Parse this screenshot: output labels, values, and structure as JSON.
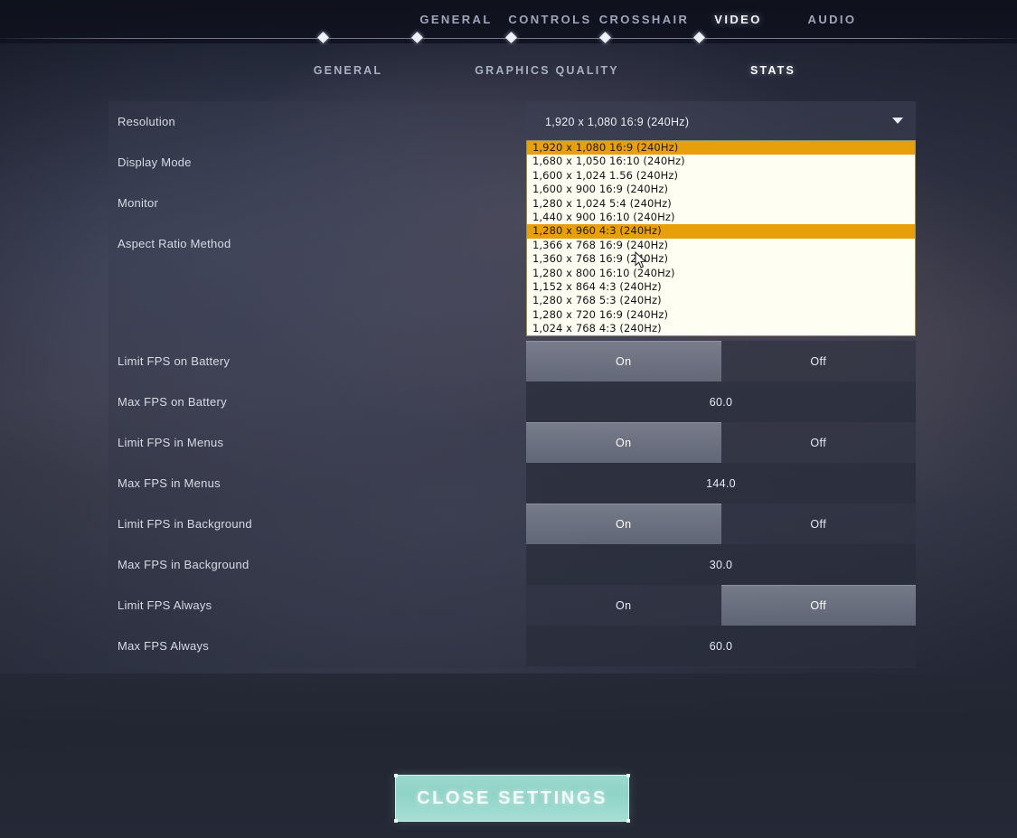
{
  "top_nav": {
    "items": [
      {
        "label": "GENERAL",
        "active": false
      },
      {
        "label": "CONTROLS",
        "active": false
      },
      {
        "label": "CROSSHAIR",
        "active": false
      },
      {
        "label": "VIDEO",
        "active": true
      },
      {
        "label": "AUDIO",
        "active": false
      }
    ]
  },
  "sub_nav": {
    "items": [
      {
        "label": "GENERAL",
        "active": false
      },
      {
        "label": "GRAPHICS QUALITY",
        "active": false
      },
      {
        "label": "STATS",
        "active": true
      }
    ]
  },
  "settings": {
    "rows": [
      {
        "label": "Resolution",
        "type": "dropdown"
      },
      {
        "label": "Display Mode",
        "type": "hidden"
      },
      {
        "label": "Monitor",
        "type": "hidden"
      },
      {
        "label": "Aspect Ratio Method",
        "type": "hidden"
      },
      {
        "label": "Limit FPS on Battery",
        "type": "toggle",
        "value": "On"
      },
      {
        "label": "Max FPS on Battery",
        "type": "value",
        "value": "60.0"
      },
      {
        "label": "Limit FPS in Menus",
        "type": "toggle",
        "value": "On"
      },
      {
        "label": "Max FPS in Menus",
        "type": "value",
        "value": "144.0"
      },
      {
        "label": "Limit FPS in Background",
        "type": "toggle",
        "value": "On"
      },
      {
        "label": "Max FPS in Background",
        "type": "value",
        "value": "30.0"
      },
      {
        "label": "Limit FPS Always",
        "type": "toggle",
        "value": "Off"
      },
      {
        "label": "Max FPS Always",
        "type": "value",
        "value": "60.0"
      }
    ],
    "toggle_labels": {
      "on": "On",
      "off": "Off"
    }
  },
  "resolution_dropdown": {
    "selected": "1,920 x 1,080 16:9 (240Hz)",
    "caret_icon": "chevron-down-icon",
    "options": [
      {
        "label": "1,920 x 1,080 16:9 (240Hz)",
        "highlight": true
      },
      {
        "label": "1,680 x 1,050 16:10 (240Hz)",
        "highlight": false
      },
      {
        "label": "1,600 x 1,024 1.56 (240Hz)",
        "highlight": false
      },
      {
        "label": "1,600 x 900 16:9 (240Hz)",
        "highlight": false
      },
      {
        "label": "1,280 x 1,024 5:4 (240Hz)",
        "highlight": false
      },
      {
        "label": "1,440 x 900 16:10 (240Hz)",
        "highlight": false
      },
      {
        "label": "1,280 x 960 4:3 (240Hz)",
        "highlight": true
      },
      {
        "label": "1,366 x 768 16:9 (240Hz)",
        "highlight": false
      },
      {
        "label": "1,360 x 768 16:9 (240Hz)",
        "highlight": false
      },
      {
        "label": "1,280 x 800 16:10 (240Hz)",
        "highlight": false
      },
      {
        "label": "1,152 x 864 4:3 (240Hz)",
        "highlight": false
      },
      {
        "label": "1,280 x 768 5:3 (240Hz)",
        "highlight": false
      },
      {
        "label": "1,280 x 720 16:9 (240Hz)",
        "highlight": false
      },
      {
        "label": "1,024 x 768 4:3 (240Hz)",
        "highlight": false
      }
    ]
  },
  "footer": {
    "close_button_label": "CLOSE SETTINGS"
  },
  "colors": {
    "dropdown_highlight": "#e8a00a",
    "dropdown_background": "#fffef2",
    "close_button": "#8fd3c7",
    "active_text": "#ffffff",
    "inactive_text": "#9fa6bb"
  }
}
